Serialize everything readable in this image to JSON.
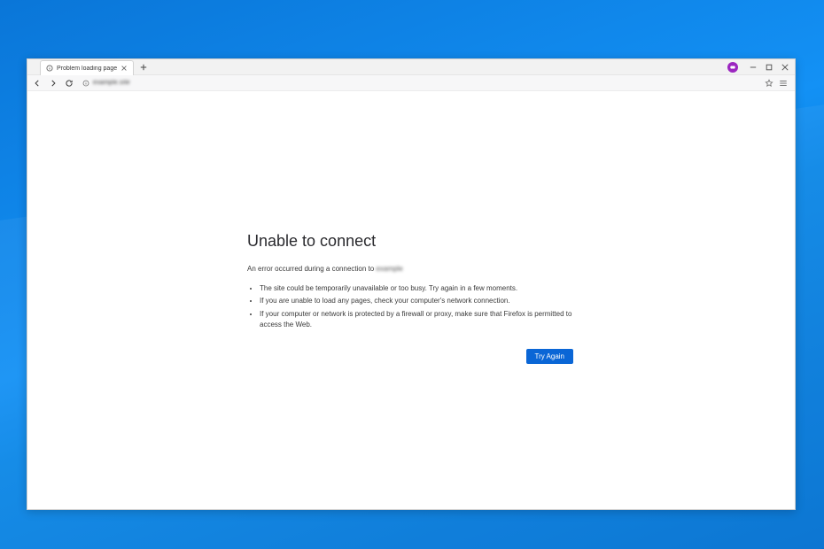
{
  "tab": {
    "title": "Problem loading page"
  },
  "address": {
    "text_obscured": "example.site"
  },
  "error": {
    "title": "Unable to connect",
    "subtitle_prefix": "An error occurred during a connection to ",
    "subtitle_host_obscured": "example",
    "bullets": [
      "The site could be temporarily unavailable or too busy. Try again in a few moments.",
      "If you are unable to load any pages, check your computer's network connection.",
      "If your computer or network is protected by a firewall or proxy, make sure that Firefox is permitted to access the Web."
    ],
    "try_again": "Try Again"
  }
}
